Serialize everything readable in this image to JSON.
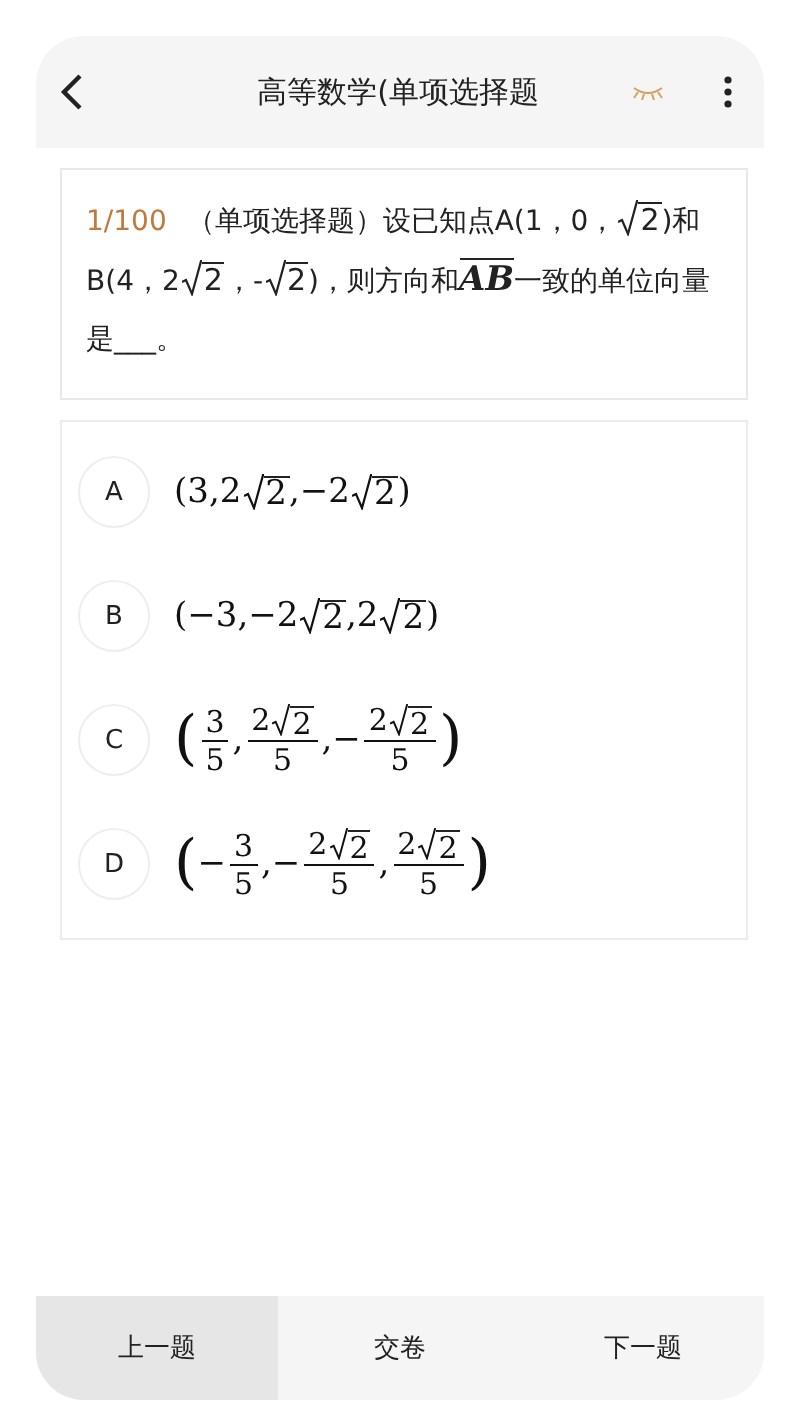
{
  "header": {
    "title": "高等数学(单项选择题"
  },
  "question": {
    "number": "1/100",
    "segments": [
      {
        "kind": "text",
        "text": "（单项选择题）设已知点A(1，0，"
      },
      {
        "kind": "sqrt",
        "text": "2"
      },
      {
        "kind": "text",
        "text": ")和B(4，2"
      },
      {
        "kind": "sqrt",
        "text": "2"
      },
      {
        "kind": "text",
        "text": "，"
      },
      {
        "kind": "text",
        "text": "-"
      },
      {
        "kind": "sqrt",
        "text": "2"
      },
      {
        "kind": "text",
        "text": ")，则方向和"
      },
      {
        "kind": "vector",
        "text": "AB"
      },
      {
        "kind": "text",
        "text": "一致的单位向量是___。"
      }
    ]
  },
  "options": [
    {
      "letter": "A",
      "selected": false,
      "parts": [
        {
          "kind": "text",
          "text": "(3,2"
        },
        {
          "kind": "sqrt",
          "text": "2"
        },
        {
          "kind": "text",
          "text": ",−2"
        },
        {
          "kind": "sqrt",
          "text": "2"
        },
        {
          "kind": "text",
          "text": ")"
        }
      ]
    },
    {
      "letter": "B",
      "selected": false,
      "parts": [
        {
          "kind": "text",
          "text": "(−3,−2"
        },
        {
          "kind": "sqrt",
          "text": "2"
        },
        {
          "kind": "text",
          "text": ",2"
        },
        {
          "kind": "sqrt",
          "text": "2"
        },
        {
          "kind": "text",
          "text": ")"
        }
      ]
    },
    {
      "letter": "C",
      "selected": false,
      "parts": [
        {
          "kind": "paren",
          "text": "("
        },
        {
          "kind": "frac",
          "num": "3",
          "den": "5"
        },
        {
          "kind": "text",
          "text": ","
        },
        {
          "kind": "frac",
          "num": "2",
          "rad": "2",
          "den": "5"
        },
        {
          "kind": "text",
          "text": ",−"
        },
        {
          "kind": "frac",
          "num": "2",
          "rad": "2",
          "den": "5"
        },
        {
          "kind": "paren",
          "text": ")"
        }
      ]
    },
    {
      "letter": "D",
      "selected": false,
      "parts": [
        {
          "kind": "paren",
          "text": "("
        },
        {
          "kind": "text",
          "text": "−"
        },
        {
          "kind": "frac",
          "num": "3",
          "den": "5"
        },
        {
          "kind": "text",
          "text": ",−"
        },
        {
          "kind": "frac",
          "num": "2",
          "rad": "2",
          "den": "5"
        },
        {
          "kind": "text",
          "text": ","
        },
        {
          "kind": "frac",
          "num": "2",
          "rad": "2",
          "den": "5"
        },
        {
          "kind": "paren",
          "text": ")"
        }
      ]
    }
  ],
  "bottom_bar": [
    {
      "label": "上一题",
      "selected": true
    },
    {
      "label": "交卷",
      "selected": false
    },
    {
      "label": "下一题",
      "selected": false
    }
  ]
}
